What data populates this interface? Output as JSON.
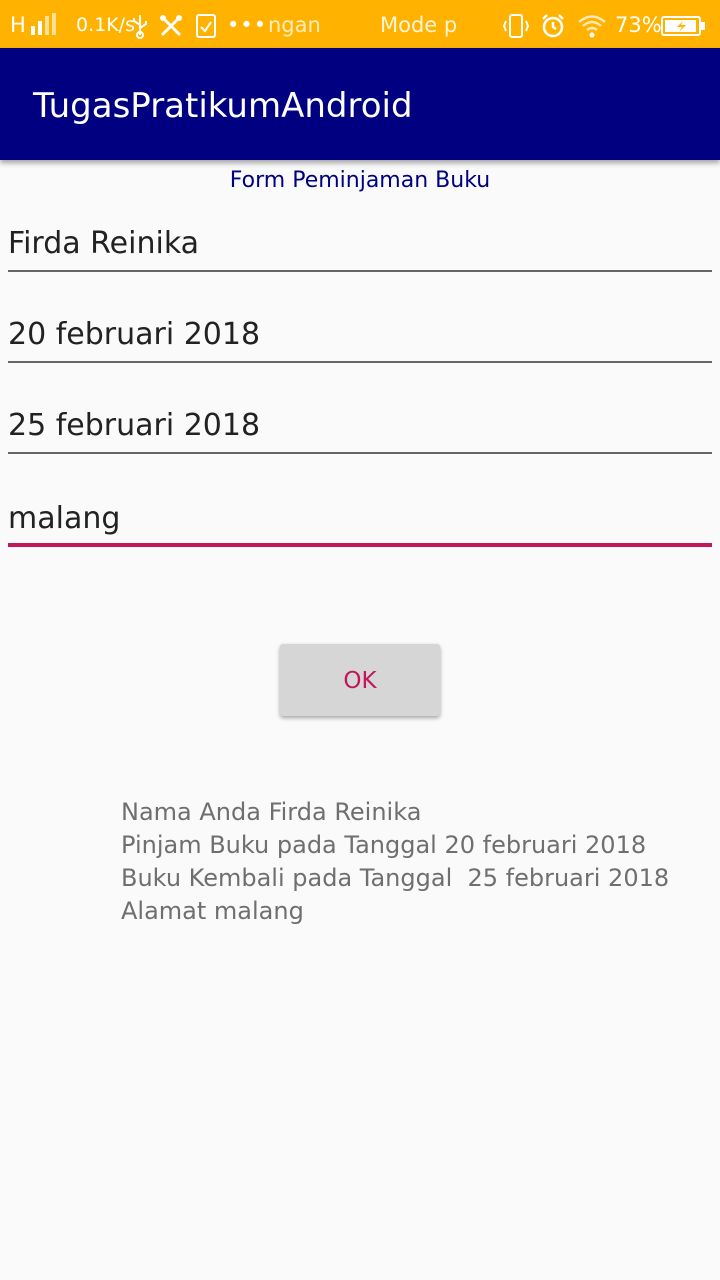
{
  "status_bar": {
    "network_type": "H",
    "speed": "0.1K/s",
    "notification_1": "ngan",
    "notification_2": "Mode p",
    "more": "•••",
    "battery": "73%"
  },
  "app_bar": {
    "title": "TugasPratikumAndroid"
  },
  "form": {
    "heading": "Form Peminjaman Buku",
    "fields": [
      {
        "value": "Firda Reinika"
      },
      {
        "value": "20 februari 2018"
      },
      {
        "value": "25 februari 2018"
      },
      {
        "value": "malang"
      }
    ],
    "ok_label": "OK"
  },
  "result": {
    "lines": [
      "Nama Anda Firda Reinika",
      "Pinjam Buku pada Tanggal 20 februari 2018",
      "Buku Kembali pada Tanggal  25 februari 2018",
      "Alamat malang"
    ]
  },
  "colors": {
    "status_bar": "#ffb300",
    "app_bar": "#000080",
    "accent": "#c2185b",
    "background": "#fafafa"
  }
}
